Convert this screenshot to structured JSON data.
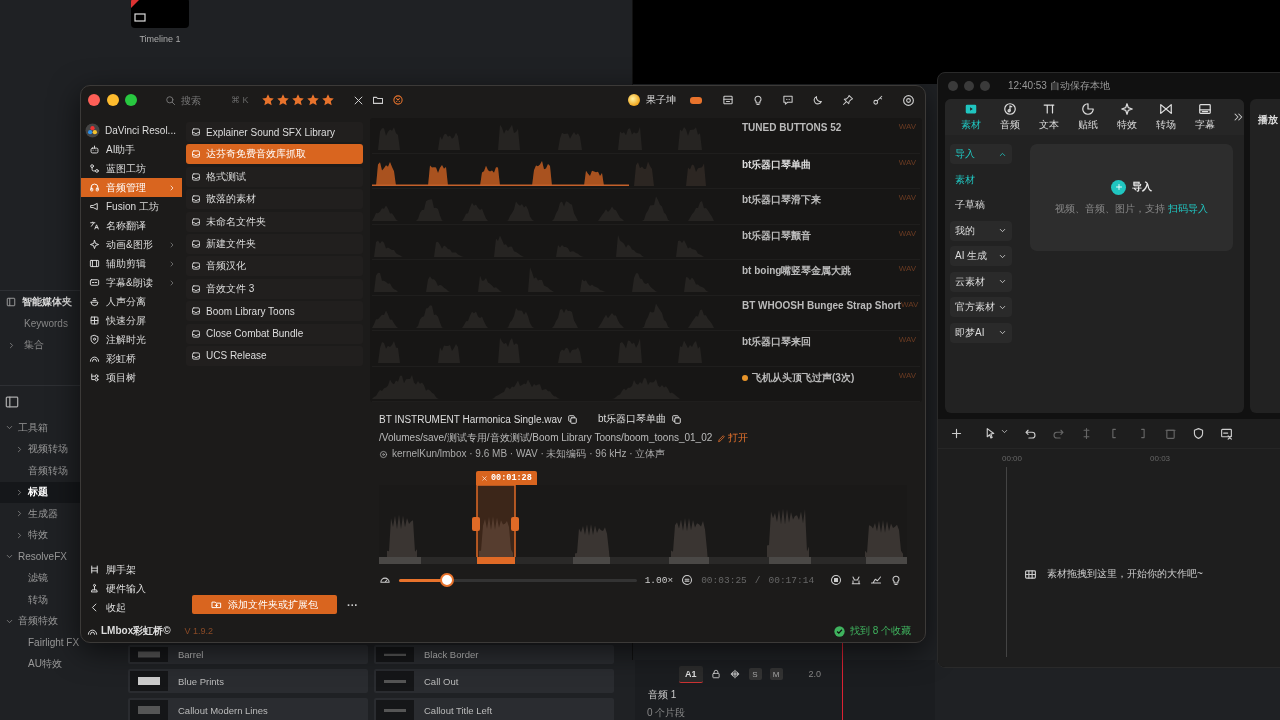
{
  "resolve": {
    "timeline_thumb": {
      "label": "Timeline 1"
    },
    "smart_bins": {
      "title": "智能媒体夹",
      "items": [
        {
          "label": "Keywords",
          "expandable": false
        },
        {
          "label": "集合",
          "expandable": true,
          "expanded": false
        }
      ]
    },
    "effects_tree": [
      {
        "label": "工具箱",
        "expandable": true,
        "expanded": true,
        "selected": false,
        "children": [
          {
            "label": "视频转场",
            "expandable": true,
            "expanded": false,
            "selected": false
          },
          {
            "label": "音频转场",
            "expandable": false,
            "selected": false
          },
          {
            "label": "标题",
            "expandable": true,
            "expanded": false,
            "selected": true
          },
          {
            "label": "生成器",
            "expandable": true,
            "expanded": false,
            "selected": false
          },
          {
            "label": "特效",
            "expandable": true,
            "expanded": false,
            "selected": false
          }
        ]
      },
      {
        "label": "ResolveFX",
        "expandable": true,
        "expanded": true,
        "selected": false,
        "children": [
          {
            "label": "滤镜",
            "expandable": false,
            "selected": false
          },
          {
            "label": "转场",
            "expandable": false,
            "selected": false
          }
        ]
      },
      {
        "label": "音频特效",
        "expandable": true,
        "expanded": true,
        "selected": false,
        "children": [
          {
            "label": "Fairlight FX",
            "expandable": false,
            "selected": false
          },
          {
            "label": "AU特效",
            "expandable": false,
            "selected": false
          }
        ]
      }
    ],
    "effect_clips": [
      {
        "label": "Barrel"
      },
      {
        "label": "Black Border"
      },
      {
        "label": "Blue Prints"
      },
      {
        "label": "Call Out"
      },
      {
        "label": "Callout Modern Lines"
      },
      {
        "label": "Callout Title Left"
      }
    ],
    "track": {
      "name": "A1",
      "solo": "S",
      "mute": "M",
      "volume": "2.0",
      "title": "音频 1",
      "clips": "0 个片段"
    }
  },
  "lmbox": {
    "search": {
      "placeholder": "搜索",
      "shortcut": "⌘ K"
    },
    "rating": {
      "stars": 5
    },
    "user": {
      "name": "果子坤"
    },
    "app_menu": {
      "label": "DaVinci Resol..."
    },
    "sidebar": [
      {
        "label": "AI助手",
        "selected": false,
        "submenu": false
      },
      {
        "label": "蓝图工坊",
        "selected": false,
        "submenu": false
      },
      {
        "label": "音频管理",
        "selected": true,
        "submenu": true
      },
      {
        "label": "Fusion 工坊",
        "selected": false,
        "submenu": false
      },
      {
        "label": "名称翻译",
        "selected": false,
        "submenu": false
      },
      {
        "label": "动画&图形",
        "selected": false,
        "submenu": true
      },
      {
        "label": "辅助剪辑",
        "selected": false,
        "submenu": true
      },
      {
        "label": "字幕&朗读",
        "selected": false,
        "submenu": true
      },
      {
        "label": "人声分离",
        "selected": false,
        "submenu": false
      },
      {
        "label": "快速分屏",
        "selected": false,
        "submenu": false
      },
      {
        "label": "注解时光",
        "selected": false,
        "submenu": false
      },
      {
        "label": "彩虹桥",
        "selected": false,
        "submenu": false
      },
      {
        "label": "项目树",
        "selected": false,
        "submenu": false
      }
    ],
    "sidebar_bottom": [
      {
        "label": "脚手架"
      },
      {
        "label": "硬件输入"
      },
      {
        "label": "收起"
      }
    ],
    "folders": [
      {
        "label": "Explainer Sound SFX Library",
        "selected": false
      },
      {
        "label": "达芬奇免费音效库抓取",
        "selected": true
      },
      {
        "label": "格式测试",
        "selected": false
      },
      {
        "label": "散落的素材",
        "selected": false
      },
      {
        "label": "未命名文件夹",
        "selected": false
      },
      {
        "label": "新建文件夹",
        "selected": false
      },
      {
        "label": "音频汉化",
        "selected": false
      },
      {
        "label": "音效文件 3",
        "selected": false
      },
      {
        "label": "Boom Library Toons",
        "selected": false
      },
      {
        "label": "Close Combat Bundle",
        "selected": false
      },
      {
        "label": "UCS Release",
        "selected": false
      }
    ],
    "add_button": "添加文件夹或扩展包",
    "more": "···",
    "sounds": [
      {
        "name": "TUNED BUTTONS 52",
        "format": "WAV",
        "selected": false,
        "marked": false
      },
      {
        "name": "bt乐器口琴单曲",
        "format": "WAV",
        "selected": true,
        "marked": false
      },
      {
        "name": "bt乐器口琴滑下来",
        "format": "WAV",
        "selected": false,
        "marked": false
      },
      {
        "name": "bt乐器口琴颤音",
        "format": "WAV",
        "selected": false,
        "marked": false
      },
      {
        "name": "bt boing嘴竖琴金属大跳",
        "format": "WAV",
        "selected": false,
        "marked": false
      },
      {
        "name": "BT WHOOSH Bungee Strap Short",
        "format": "WAV",
        "selected": false,
        "marked": false
      },
      {
        "name": "bt乐器口琴来回",
        "format": "WAV",
        "selected": false,
        "marked": false
      },
      {
        "name": "飞机从头顶飞过声(3次)",
        "format": "WAV",
        "selected": false,
        "marked": true
      }
    ],
    "detail": {
      "filename": "BT INSTRUMENT Harmonica Single.wav",
      "title": "bt乐器口琴单曲",
      "path": "/Volumes/save/测试专用/音效测试/Boom Library Toons/boom_toons_01_02",
      "open": "打开",
      "info": "kernelKun/lmbox · 9.6 MB · WAV · 未知编码 · 96 kHz · 立体声",
      "selection_time": "00:01:28",
      "speed": {
        "level": 0.2,
        "label": "1.00×"
      },
      "position": "00:03:25",
      "separator": "/",
      "duration": "00:17:14"
    },
    "footer": {
      "brand": "LMbox彩虹桥©",
      "version": "V 1.9.2",
      "status": "找到 8 个收藏"
    }
  },
  "capcut": {
    "title": "12:40:53 自动保存本地",
    "tabs": [
      {
        "label": "素材",
        "selected": true
      },
      {
        "label": "音频",
        "selected": false
      },
      {
        "label": "文本",
        "selected": false
      },
      {
        "label": "贴纸",
        "selected": false
      },
      {
        "label": "特效",
        "selected": false
      },
      {
        "label": "转场",
        "selected": false
      },
      {
        "label": "字幕",
        "selected": false
      }
    ],
    "player_title": "播放",
    "menu": [
      {
        "label": "导入",
        "selected": true,
        "expandable": true,
        "expanded": true
      },
      {
        "label": "素材",
        "selected": true,
        "expandable": false
      },
      {
        "label": "子草稿",
        "selected": false,
        "expandable": false
      },
      {
        "label": "我的",
        "selected": false,
        "expandable": true,
        "expanded": false
      },
      {
        "label": "AI 生成",
        "selected": false,
        "expandable": true,
        "expanded": false
      },
      {
        "label": "云素材",
        "selected": false,
        "expandable": true,
        "expanded": false
      },
      {
        "label": "官方素材",
        "selected": false,
        "expandable": true,
        "expanded": false
      },
      {
        "label": "即梦AI",
        "selected": false,
        "expandable": true,
        "expanded": false
      }
    ],
    "import_card": {
      "title": "导入",
      "hint": "视频、音频、图片，支持",
      "link": "扫码导入"
    },
    "ruler": [
      "00:00",
      "00:03"
    ],
    "empty_hint": "素材拖拽到这里，开始你的大作吧~"
  }
}
